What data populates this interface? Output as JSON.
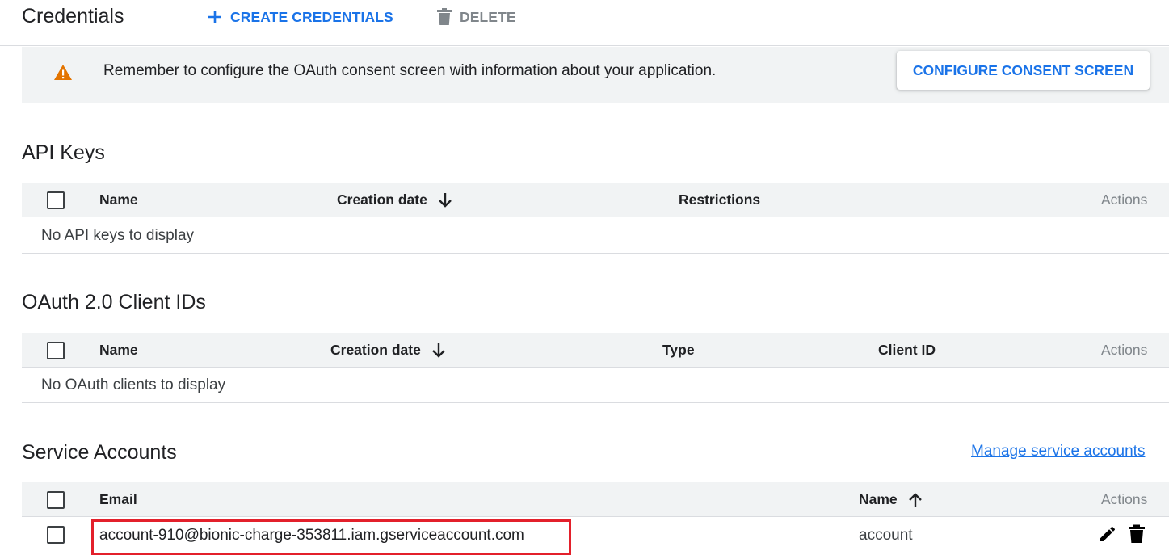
{
  "header": {
    "title": "Credentials",
    "create_label": "CREATE CREDENTIALS",
    "delete_label": "DELETE"
  },
  "banner": {
    "message": "Remember to configure the OAuth consent screen with information about your application.",
    "button_label": "CONFIGURE CONSENT SCREEN"
  },
  "api_keys": {
    "title": "API Keys",
    "columns": [
      "Name",
      "Creation date",
      "Restrictions",
      "Actions"
    ],
    "sort_column": "Creation date",
    "sort_direction": "descending",
    "empty_message": "No API keys to display"
  },
  "oauth": {
    "title": "OAuth 2.0 Client IDs",
    "columns": [
      "Name",
      "Creation date",
      "Type",
      "Client ID",
      "Actions"
    ],
    "sort_column": "Creation date",
    "sort_direction": "descending",
    "empty_message": "No OAuth clients to display"
  },
  "service_accounts": {
    "title": "Service Accounts",
    "manage_link": "Manage service accounts",
    "columns": [
      "Email",
      "Name",
      "Actions"
    ],
    "sort_column": "Name",
    "sort_direction": "ascending",
    "rows": [
      {
        "email": "account-910@bionic-charge-353811.iam.gserviceaccount.com",
        "name": "account",
        "actions": [
          "edit-icon",
          "delete-icon"
        ]
      }
    ]
  },
  "colors": {
    "accent": "#1a73e8",
    "warning": "#e37400",
    "highlight_border": "#e3202b",
    "header_bg": "#f1f3f4"
  }
}
